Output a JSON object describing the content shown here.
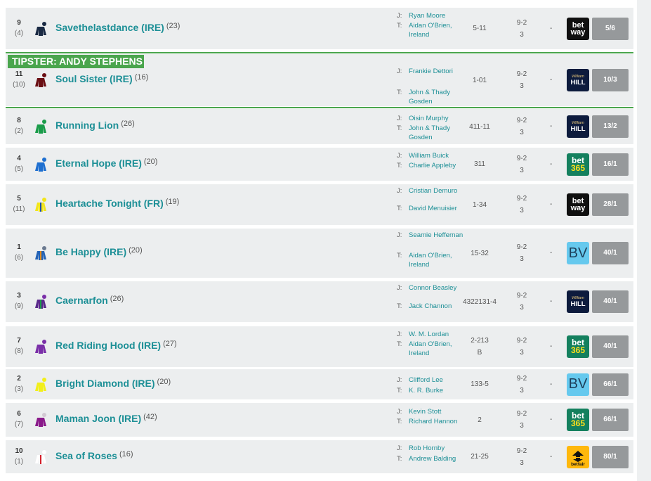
{
  "tipster_label": "TIPSTER: ANDY STEPHENS",
  "runners": [
    {
      "number": "9",
      "draw": "(4)",
      "name": "Savethelastdance (IRE)",
      "age": "(23)",
      "jockey": "Ryan Moore",
      "trainer": "Aidan O'Brien, Ireland",
      "form": "5-11",
      "form_extra": "",
      "weight": "9-2",
      "weight_extra": "3",
      "dash": "-",
      "bookmaker": "betway",
      "odds": "5/6",
      "silk_body": "#1a2a44",
      "silk_cap": "#1a2a44",
      "silk_accent": "#1a2a44"
    },
    {
      "number": "11",
      "draw": "(10)",
      "name": "Soul Sister (IRE)",
      "age": "(16)",
      "jockey": "Frankie Dettori",
      "trainer": "John & Thady Gosden",
      "form": "1-01",
      "form_extra": "",
      "weight": "9-2",
      "weight_extra": "3",
      "dash": "-",
      "bookmaker": "william-hill",
      "odds": "10/3",
      "silk_body": "#6b0f14",
      "silk_cap": "#6b0f14",
      "silk_accent": "#6b0f14"
    },
    {
      "number": "8",
      "draw": "(2)",
      "name": "Running Lion",
      "age": "(26)",
      "jockey": "Oisin Murphy",
      "trainer": "John & Thady Gosden",
      "form": "411-11",
      "form_extra": "",
      "weight": "9-2",
      "weight_extra": "3",
      "dash": "-",
      "bookmaker": "william-hill",
      "odds": "13/2",
      "silk_body": "#1a9c4a",
      "silk_cap": "#1a9c4a",
      "silk_accent": "#1a9c4a"
    },
    {
      "number": "4",
      "draw": "(5)",
      "name": "Eternal Hope (IRE)",
      "age": "(20)",
      "jockey": "William Buick",
      "trainer": "Charlie Appleby",
      "form": "311",
      "form_extra": "",
      "weight": "9-2",
      "weight_extra": "3",
      "dash": "-",
      "bookmaker": "bet365",
      "odds": "16/1",
      "silk_body": "#1e6fd0",
      "silk_cap": "#1e6fd0",
      "silk_accent": "#1e6fd0"
    },
    {
      "number": "5",
      "draw": "(11)",
      "name": "Heartache Tonight (FR)",
      "age": "(19)",
      "jockey": "Cristian Demuro",
      "trainer": "David Menuisier",
      "form": "1-34",
      "form_extra": "",
      "weight": "9-2",
      "weight_extra": "3",
      "dash": "-",
      "bookmaker": "betway",
      "odds": "28/1",
      "silk_body": "#f2e51a",
      "silk_cap": "#f2e51a",
      "silk_accent": "#1f4fa8"
    },
    {
      "number": "1",
      "draw": "(6)",
      "name": "Be Happy (IRE)",
      "age": "(20)",
      "jockey": "Seamie Heffernan",
      "trainer": "Aidan O'Brien, Ireland",
      "form": "15-32",
      "form_extra": "",
      "weight": "9-2",
      "weight_extra": "3",
      "dash": "-",
      "bookmaker": "bv",
      "odds": "40/1",
      "silk_body": "#2563b5",
      "silk_cap": "#6b7a90",
      "silk_accent": "#e08a1c"
    },
    {
      "number": "3",
      "draw": "(9)",
      "name": "Caernarfon",
      "age": "(26)",
      "jockey": "Connor Beasley",
      "trainer": "Jack Channon",
      "form": "4322131-4",
      "form_extra": "",
      "weight": "9-2",
      "weight_extra": "3",
      "dash": "-",
      "bookmaker": "william-hill",
      "odds": "40/1",
      "silk_body": "#5a2a8a",
      "silk_cap": "#7a2fa8",
      "silk_accent": "#1a9c4a"
    },
    {
      "number": "7",
      "draw": "(8)",
      "name": "Red Riding Hood (IRE)",
      "age": "(27)",
      "jockey": "W. M. Lordan",
      "trainer": "Aidan O'Brien, Ireland",
      "form": "2-213",
      "form_extra": "B",
      "weight": "9-2",
      "weight_extra": "3",
      "dash": "-",
      "bookmaker": "bet365",
      "odds": "40/1",
      "silk_body": "#7a2fa8",
      "silk_cap": "#7a2fa8",
      "silk_accent": "#7a2fa8"
    },
    {
      "number": "2",
      "draw": "(3)",
      "name": "Bright Diamond (IRE)",
      "age": "(20)",
      "jockey": "Clifford Lee",
      "trainer": "K. R. Burke",
      "form": "133-5",
      "form_extra": "",
      "weight": "9-2",
      "weight_extra": "3",
      "dash": "-",
      "bookmaker": "bv",
      "odds": "66/1",
      "silk_body": "#f2ef1a",
      "silk_cap": "#f2ef1a",
      "silk_accent": "#f2ef1a"
    },
    {
      "number": "6",
      "draw": "(7)",
      "name": "Maman Joon (IRE)",
      "age": "(42)",
      "jockey": "Kevin Stott",
      "trainer": "Richard Hannon",
      "form": "2",
      "form_extra": "",
      "weight": "9-2",
      "weight_extra": "3",
      "dash": "-",
      "bookmaker": "bet365",
      "odds": "66/1",
      "silk_body": "#8a1a8a",
      "silk_cap": "#d2c9d2",
      "silk_accent": "#8a1a8a"
    },
    {
      "number": "10",
      "draw": "(1)",
      "name": "Sea of Roses",
      "age": "(16)",
      "jockey": "Rob Hornby",
      "trainer": "Andrew Balding",
      "form": "21-25",
      "form_extra": "",
      "weight": "9-2",
      "weight_extra": "3",
      "dash": "-",
      "bookmaker": "betfair",
      "odds": "80/1",
      "silk_body": "#ffffff",
      "silk_cap": "#ffffff",
      "silk_accent": "#d3212c"
    }
  ],
  "bookmakers": {
    "betway": {
      "line1": "bet",
      "line2": "way"
    },
    "william-hill": {
      "script": "William",
      "main": "HILL"
    },
    "bet365": {
      "line1": "bet",
      "line2": "365"
    },
    "bv": {
      "text": "BV"
    },
    "betfair": {
      "text": "betfair"
    }
  },
  "labels": {
    "jockey": "J:",
    "trainer": "T:"
  }
}
